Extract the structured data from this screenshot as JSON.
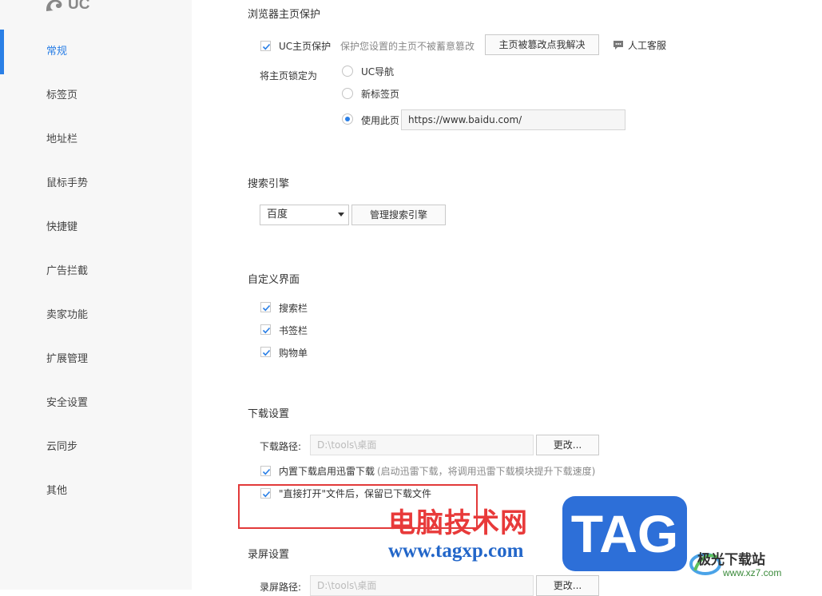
{
  "logo": {
    "text": "UC"
  },
  "sidebar": {
    "items": [
      {
        "label": "常规"
      },
      {
        "label": "标签页"
      },
      {
        "label": "地址栏"
      },
      {
        "label": "鼠标手势"
      },
      {
        "label": "快捷键"
      },
      {
        "label": "广告拦截"
      },
      {
        "label": "卖家功能"
      },
      {
        "label": "扩展管理"
      },
      {
        "label": "安全设置"
      },
      {
        "label": "云同步"
      },
      {
        "label": "其他"
      }
    ]
  },
  "homepage": {
    "title": "浏览器主页保护",
    "protect_label": "UC主页保护",
    "protect_hint": "保护您设置的主页不被蓄意篡改",
    "fix_button": "主页被篡改点我解决",
    "support_label": "人工客服",
    "lock_label": "将主页锁定为",
    "options": [
      "UC导航",
      "新标签页",
      "使用此页"
    ],
    "url": "https://www.baidu.com/"
  },
  "search": {
    "title": "搜索引擎",
    "selected": "百度",
    "manage_button": "管理搜索引擎"
  },
  "custom_ui": {
    "title": "自定义界面",
    "items": [
      "搜索栏",
      "书签栏",
      "购物单"
    ]
  },
  "download": {
    "title": "下载设置",
    "path_label": "下载路径:",
    "path_value": "D:\\tools\\桌面",
    "change_button": "更改...",
    "thunder_label": "内置下载启用迅雷下载",
    "thunder_hint": "(启动迅雷下载，将调用迅雷下载模块提升下载速度)",
    "keep_label": "\"直接打开\"文件后，保留已下载文件"
  },
  "record": {
    "title": "录屏设置",
    "path_label": "录屏路径:",
    "path_value": "D:\\tools\\桌面",
    "change_button": "更改..."
  },
  "watermark": {
    "cn": "电脑技术网",
    "url": "www.tagxp.com",
    "tag": "TAG",
    "site": "极光下载站",
    "site_url": "www.xz7.com"
  }
}
